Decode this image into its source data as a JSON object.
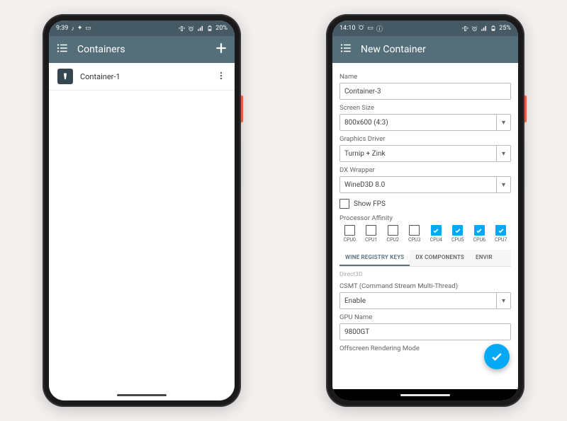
{
  "left": {
    "status": {
      "time": "9:39",
      "battery": "20%"
    },
    "appbar": {
      "title": "Containers"
    },
    "items": [
      {
        "name": "Container-1"
      }
    ]
  },
  "right": {
    "status": {
      "time": "14:10",
      "battery": "25%"
    },
    "appbar": {
      "title": "New Container"
    },
    "form": {
      "name_label": "Name",
      "name_value": "Container-3",
      "screen_label": "Screen Size",
      "screen_value": "800x600 (4:3)",
      "gfx_label": "Graphics Driver",
      "gfx_value": "Turnip + Zink",
      "dx_label": "DX Wrapper",
      "dx_value": "WineD3D 8.0",
      "showfps_label": "Show FPS",
      "showfps_checked": false,
      "affinity_label": "Processor Affinity",
      "cpus": [
        {
          "label": "CPU0",
          "checked": false
        },
        {
          "label": "CPU1",
          "checked": false
        },
        {
          "label": "CPU2",
          "checked": false
        },
        {
          "label": "CPU3",
          "checked": false
        },
        {
          "label": "CPU4",
          "checked": true
        },
        {
          "label": "CPU5",
          "checked": true
        },
        {
          "label": "CPU6",
          "checked": true
        },
        {
          "label": "CPU7",
          "checked": true
        }
      ],
      "tabs": [
        {
          "label": "WINE REGISTRY KEYS",
          "active": true
        },
        {
          "label": "DX COMPONENTS",
          "active": false
        },
        {
          "label": "ENVIR",
          "active": false
        }
      ],
      "d3d_header": "Direct3D",
      "csmt_label": "CSMT (Command Stream Multi-Thread)",
      "csmt_value": "Enable",
      "gpu_label": "GPU Name",
      "gpu_value": "9800GT",
      "offscreen_label": "Offscreen Rendering Mode"
    }
  }
}
